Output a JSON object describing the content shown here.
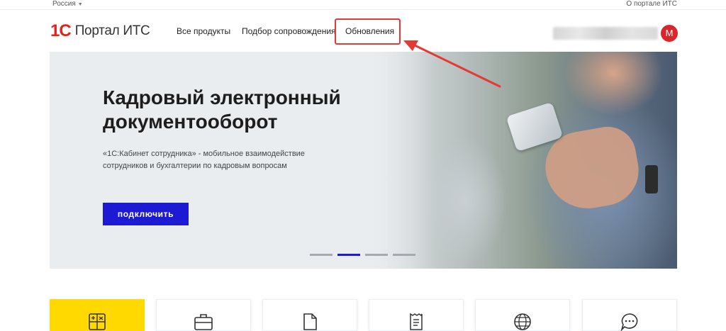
{
  "topbar": {
    "region": "Россия",
    "about": "О портале ИТС"
  },
  "header": {
    "logo_text": "Портал ИТС",
    "nav": [
      {
        "label": "Все продукты"
      },
      {
        "label": "Подбор сопровождения"
      },
      {
        "label": "Обновления"
      }
    ],
    "avatar_letter": "М"
  },
  "banner": {
    "title": "Кадровый электронный документооборот",
    "subtitle": "«1С:Кабинет сотрудника» - мобильное взаимодействие сотрудников и бухгалтерии по кадровым вопросам",
    "button": "подключить",
    "slides": 4,
    "active_slide": 2
  },
  "tiles": [
    {
      "icon": "calculator-icon",
      "highlight": true
    },
    {
      "icon": "briefcase-icon",
      "highlight": false
    },
    {
      "icon": "document-icon",
      "highlight": false
    },
    {
      "icon": "receipt-icon",
      "highlight": false
    },
    {
      "icon": "globe-icon",
      "highlight": false
    },
    {
      "icon": "chat-icon",
      "highlight": false
    }
  ],
  "colors": {
    "accent": "#1d1ad4",
    "brand": "#e2231a",
    "annotation": "#e53935",
    "tile_highlight": "#ffd900"
  }
}
